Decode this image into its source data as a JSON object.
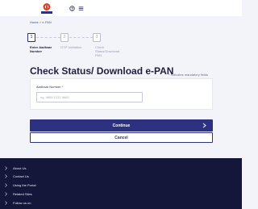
{
  "header": {
    "logo_icon": "tax-department-emblem",
    "help_icon": "help-circle-icon",
    "menu_icon": "hamburger-menu-icon"
  },
  "breadcrumb": {
    "home": "Home",
    "separator": ">",
    "current": "e-PAN"
  },
  "stepper": {
    "steps": [
      {
        "number": "1",
        "label": "Enter Aadhaar Number",
        "state": "active"
      },
      {
        "number": "2",
        "label": "OTP Validation",
        "state": "pending"
      },
      {
        "number": "3",
        "label": "Check Status/Download PAN",
        "state": "pending"
      }
    ]
  },
  "page": {
    "title": "Check Status/ Download e-PAN",
    "mandatory_note": "* Indicates mandatory fields"
  },
  "form": {
    "aadhaar_label": "Aadhaar Number *",
    "aadhaar_value": "",
    "aadhaar_placeholder": "eg. 9865 1232 9865"
  },
  "actions": {
    "continue_label": "Continue",
    "cancel_label": "Cancel"
  },
  "footer": {
    "items": [
      "About Us",
      "Contact Us",
      "Using the Portal",
      "Related Sites",
      "Follow us on"
    ]
  },
  "colors": {
    "primary": "#2c3180",
    "footer_bg": "#14163a",
    "page_bg": "#f3f4f9"
  }
}
